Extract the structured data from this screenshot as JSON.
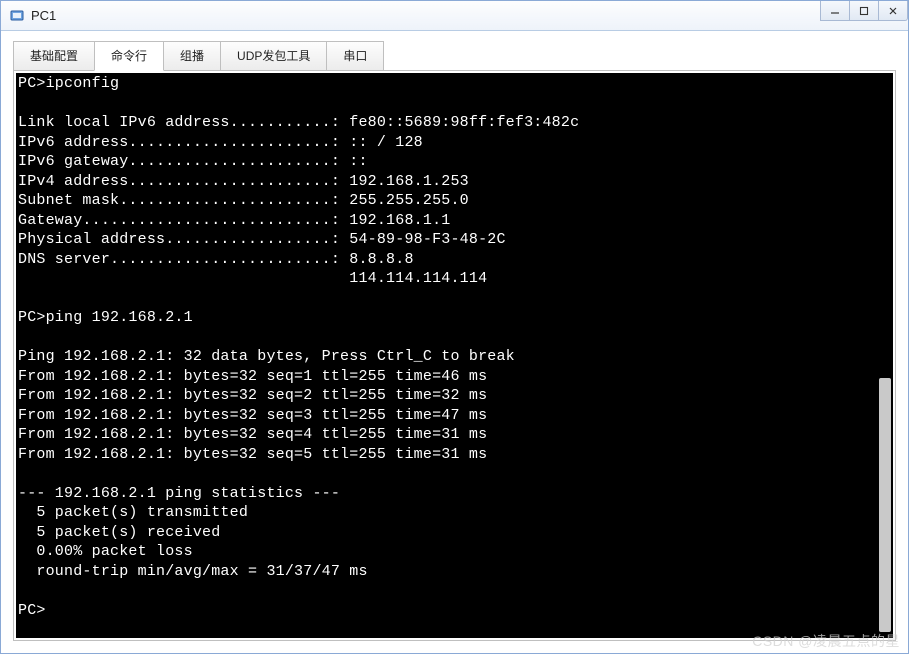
{
  "window": {
    "title": "PC1",
    "buttons": {
      "minimize": "—",
      "maximize": "□",
      "close": "X"
    }
  },
  "tabs": [
    {
      "label": "基础配置",
      "active": false
    },
    {
      "label": "命令行",
      "active": true
    },
    {
      "label": "组播",
      "active": false
    },
    {
      "label": "UDP发包工具",
      "active": false
    },
    {
      "label": "串口",
      "active": false
    }
  ],
  "terminal": {
    "lines": [
      "PC>ipconfig",
      "",
      "Link local IPv6 address...........: fe80::5689:98ff:fef3:482c",
      "IPv6 address......................: :: / 128",
      "IPv6 gateway......................: ::",
      "IPv4 address......................: 192.168.1.253",
      "Subnet mask.......................: 255.255.255.0",
      "Gateway...........................: 192.168.1.1",
      "Physical address..................: 54-89-98-F3-48-2C",
      "DNS server........................: 8.8.8.8",
      "                                    114.114.114.114",
      "",
      "PC>ping 192.168.2.1",
      "",
      "Ping 192.168.2.1: 32 data bytes, Press Ctrl_C to break",
      "From 192.168.2.1: bytes=32 seq=1 ttl=255 time=46 ms",
      "From 192.168.2.1: bytes=32 seq=2 ttl=255 time=32 ms",
      "From 192.168.2.1: bytes=32 seq=3 ttl=255 time=47 ms",
      "From 192.168.2.1: bytes=32 seq=4 ttl=255 time=31 ms",
      "From 192.168.2.1: bytes=32 seq=5 ttl=255 time=31 ms",
      "",
      "--- 192.168.2.1 ping statistics ---",
      "  5 packet(s) transmitted",
      "  5 packet(s) received",
      "  0.00% packet loss",
      "  round-trip min/avg/max = 31/37/47 ms",
      "",
      "PC>"
    ]
  },
  "watermark": "CSDN @凌晨五点的星"
}
